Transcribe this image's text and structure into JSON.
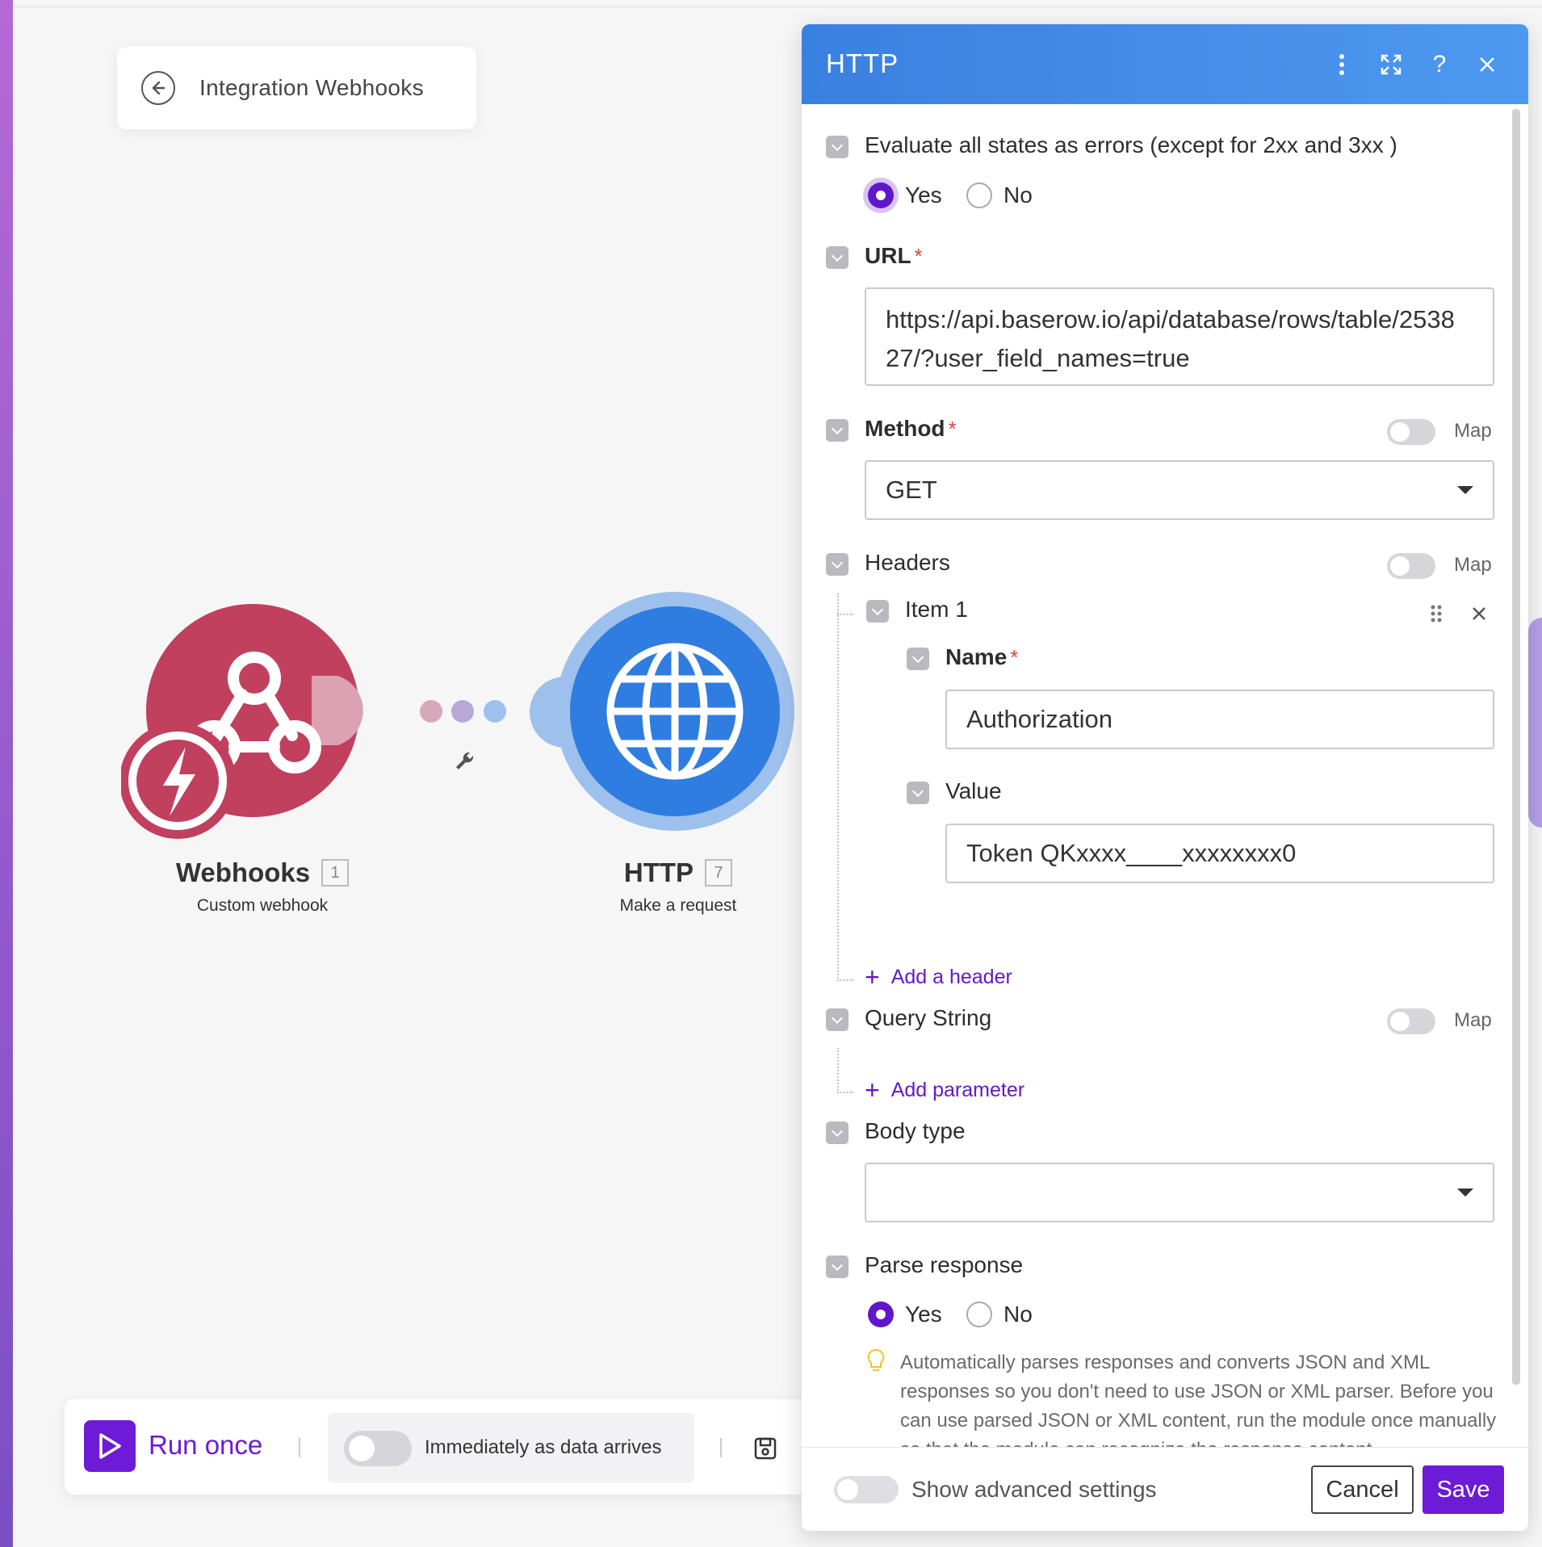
{
  "breadcrumb": {
    "title": "Integration Webhooks"
  },
  "modules": [
    {
      "name": "Webhooks",
      "badge": "1",
      "subtitle": "Custom webhook",
      "color": "#c0405e"
    },
    {
      "name": "HTTP",
      "badge": "7",
      "subtitle": "Make a request",
      "color": "#2f7de0"
    }
  ],
  "toolbar": {
    "run_label": "Run once",
    "schedule_label": "Immediately as data arrives"
  },
  "panel": {
    "title": "HTTP",
    "evaluate_errors": {
      "label": "Evaluate all states as errors (except for 2xx and 3xx )",
      "yes": "Yes",
      "no": "No",
      "selected": "Yes"
    },
    "url": {
      "label": "URL",
      "value": "https://api.baserow.io/api/database/rows/table/253827/?user_field_names=true"
    },
    "method": {
      "label": "Method",
      "value": "GET",
      "map_label": "Map"
    },
    "headers": {
      "label": "Headers",
      "map_label": "Map",
      "item_label": "Item 1",
      "name_label": "Name",
      "name_value": "Authorization",
      "value_label": "Value",
      "value_value": "Token QKxxxx____xxxxxxxx0",
      "add_label": "Add a header"
    },
    "query_string": {
      "label": "Query String",
      "map_label": "Map",
      "add_label": "Add parameter"
    },
    "body_type": {
      "label": "Body type",
      "value": ""
    },
    "parse_response": {
      "label": "Parse response",
      "yes": "Yes",
      "no": "No",
      "selected": "Yes",
      "hint": "Automatically parses responses and converts JSON and XML responses so you don't need to use JSON or XML parser. Before you can use parsed JSON or XML content, run the module once manually so that the module can recognize the response content"
    },
    "footer": {
      "advanced_label": "Show advanced settings",
      "cancel_label": "Cancel",
      "save_label": "Save"
    }
  },
  "colors": {
    "accent": "#6d1bd6",
    "header": "#3a80e1"
  }
}
